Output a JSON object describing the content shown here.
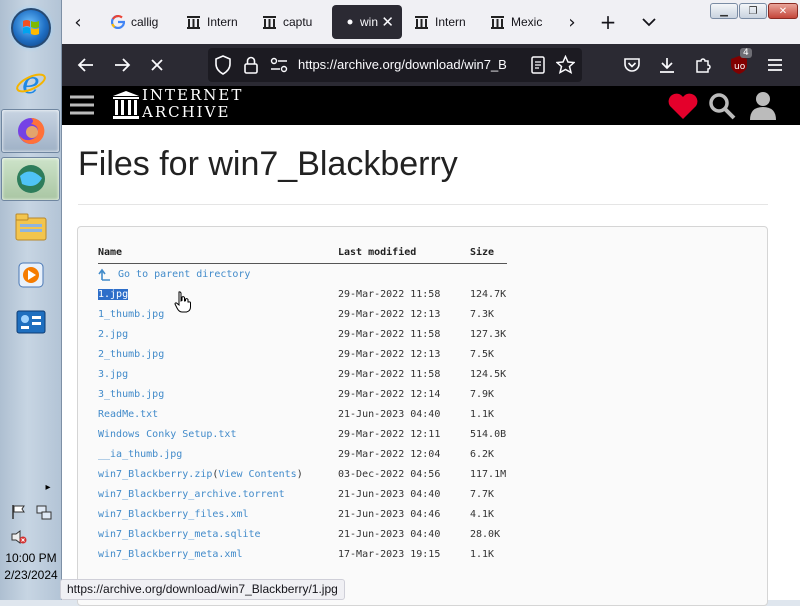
{
  "taskbar": {
    "time": "10:00 PM",
    "date": "2/23/2024",
    "expand_glyph": "▸"
  },
  "tabs": [
    {
      "label": "callig",
      "favicon": "google-g"
    },
    {
      "label": "Intern",
      "favicon": "archive-pillars"
    },
    {
      "label": "captu",
      "favicon": "archive-pillars"
    },
    {
      "label": "win",
      "favicon": "loading-dot",
      "selected": true
    },
    {
      "label": "Intern",
      "favicon": "archive-pillars"
    },
    {
      "label": "Mexic",
      "favicon": "archive-pillars"
    }
  ],
  "toolbar": {
    "url": "https://archive.org/download/win7_B",
    "extension_badge": "4"
  },
  "ia": {
    "logo_line1": "INTERNET",
    "logo_line2": "ARCHIVE"
  },
  "page": {
    "title": "Files for win7_Blackberry",
    "columns": {
      "name": "Name",
      "modified": "Last modified",
      "size": "Size"
    },
    "parent_link": "Go to parent directory",
    "files": [
      {
        "name": "1.jpg",
        "modified": "29-Mar-2022 11:58",
        "size": "124.7K"
      },
      {
        "name": "1_thumb.jpg",
        "modified": "29-Mar-2022 12:13",
        "size": "7.3K"
      },
      {
        "name": "2.jpg",
        "modified": "29-Mar-2022 11:58",
        "size": "127.3K"
      },
      {
        "name": "2_thumb.jpg",
        "modified": "29-Mar-2022 12:13",
        "size": "7.5K"
      },
      {
        "name": "3.jpg",
        "modified": "29-Mar-2022 11:58",
        "size": "124.5K"
      },
      {
        "name": "3_thumb.jpg",
        "modified": "29-Mar-2022 12:14",
        "size": "7.9K"
      },
      {
        "name": "ReadMe.txt",
        "modified": "21-Jun-2023 04:40",
        "size": "1.1K"
      },
      {
        "name": "Windows Conky Setup.txt",
        "modified": "29-Mar-2022 12:11",
        "size": "514.0B"
      },
      {
        "name": "__ia_thumb.jpg",
        "modified": "29-Mar-2022 12:04",
        "size": "6.2K"
      },
      {
        "name": "win7_Blackberry.zip",
        "extra_open": " (",
        "extra_link": "View Contents",
        "extra_close": ")",
        "modified": "03-Dec-2022 04:56",
        "size": "117.1M"
      },
      {
        "name": "win7_Blackberry_archive.torrent",
        "modified": "21-Jun-2023 04:40",
        "size": "7.7K"
      },
      {
        "name": "win7_Blackberry_files.xml",
        "modified": "21-Jun-2023 04:46",
        "size": "4.1K"
      },
      {
        "name": "win7_Blackberry_meta.sqlite",
        "modified": "21-Jun-2023 04:40",
        "size": "28.0K"
      },
      {
        "name": "win7_Blackberry_meta.xml",
        "modified": "17-Mar-2023 19:15",
        "size": "1.1K"
      }
    ]
  },
  "status_url": "https://archive.org/download/win7_Blackberry/1.jpg",
  "colors": {
    "link": "#428bca",
    "heart": "#e4002b",
    "nav_bg": "#2b2a33"
  }
}
